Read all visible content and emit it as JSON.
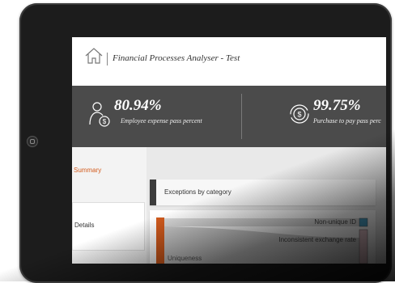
{
  "app": {
    "title": "Financial Processes Analyser - Test",
    "home_icon": "home-icon"
  },
  "kpis": [
    {
      "value": "80.94%",
      "label": "Employee expense pass percent",
      "icon": "employee-expense-icon"
    },
    {
      "value": "99.75%",
      "label": "Purchase to pay pass perc",
      "icon": "purchase-to-pay-icon"
    }
  ],
  "nav": {
    "summary": "Summary",
    "details": "Details"
  },
  "exceptions": {
    "title": "Exceptions by category",
    "categories": [
      "Uniqueness"
    ],
    "types": [
      "Non-unique ID",
      "Inconsistent exchange rate"
    ]
  },
  "colors": {
    "accent": "#d35b1d",
    "kpi_bar": "#4b4b4b",
    "non_unique_id": "#4aa3c8",
    "inconsistent_rate": "#e6c4cb"
  }
}
